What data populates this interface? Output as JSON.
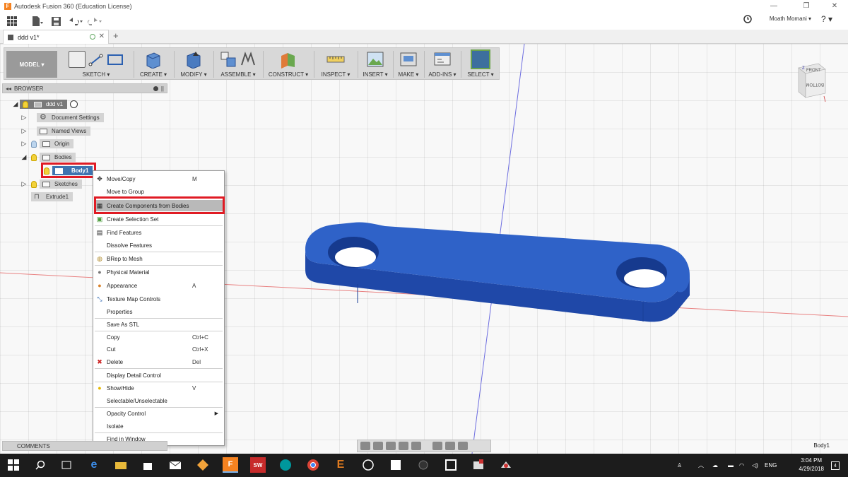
{
  "window": {
    "title": "Autodesk Fusion 360 (Education License)",
    "minimize": "—",
    "restore": "❐",
    "close": "✕"
  },
  "qat": {
    "user": "Moath Momani ▾",
    "help": "? ▾"
  },
  "doc_tab": {
    "label": "ddd v1*",
    "close": "✕",
    "new_tab": "+"
  },
  "ribbon": {
    "model": "MODEL ▾",
    "groups": [
      {
        "label": "SKETCH ▾"
      },
      {
        "label": "CREATE ▾"
      },
      {
        "label": "MODIFY ▾"
      },
      {
        "label": "ASSEMBLE ▾"
      },
      {
        "label": "CONSTRUCT ▾"
      },
      {
        "label": "INSPECT ▾"
      },
      {
        "label": "INSERT ▾"
      },
      {
        "label": "MAKE ▾"
      },
      {
        "label": "ADD-INS ▾"
      },
      {
        "label": "SELECT ▾"
      }
    ]
  },
  "browser": {
    "title": "BROWSER",
    "root": "ddd v1",
    "items": {
      "document_settings": "Document Settings",
      "named_views": "Named Views",
      "origin": "Origin",
      "bodies": "Bodies",
      "body1": "Body1",
      "sketches": "Sketches",
      "extrude1": "Extrude1"
    }
  },
  "context_menu": {
    "items": [
      {
        "label": "Move/Copy",
        "key": "M"
      },
      {
        "label": "Move to Group",
        "key": ""
      },
      {
        "label": "Create Components from Bodies",
        "key": ""
      },
      {
        "label": "Create Selection Set",
        "key": ""
      },
      {
        "label": "Find Features",
        "key": ""
      },
      {
        "label": "Dissolve Features",
        "key": ""
      },
      {
        "label": "BRep to Mesh",
        "key": ""
      },
      {
        "label": "Physical Material",
        "key": ""
      },
      {
        "label": "Appearance",
        "key": "A"
      },
      {
        "label": "Texture Map Controls",
        "key": ""
      },
      {
        "label": "Properties",
        "key": ""
      },
      {
        "label": "Save As STL",
        "key": ""
      },
      {
        "label": "Copy",
        "key": "Ctrl+C"
      },
      {
        "label": "Cut",
        "key": "Ctrl+X"
      },
      {
        "label": "Delete",
        "key": "Del"
      },
      {
        "label": "Display Detail Control",
        "key": ""
      },
      {
        "label": "Show/Hide",
        "key": "V"
      },
      {
        "label": "Selectable/Unselectable",
        "key": ""
      },
      {
        "label": "Opacity Control",
        "key": ""
      },
      {
        "label": "Isolate",
        "key": ""
      },
      {
        "label": "Find in Window",
        "key": ""
      }
    ]
  },
  "comments": {
    "title": "COMMENTS"
  },
  "status": {
    "selection": "Body1"
  },
  "viewcube": {
    "front": "FRONT",
    "bottom": "BOTTOM",
    "z": "Z"
  },
  "taskbar": {
    "time": "3:04 PM",
    "date": "4/29/2018",
    "lang": "ENG",
    "notifications": "4"
  },
  "colors": {
    "body_blue": "#2f62c8",
    "highlight_red": "#e01b24",
    "select_blue": "#3e73b0"
  }
}
